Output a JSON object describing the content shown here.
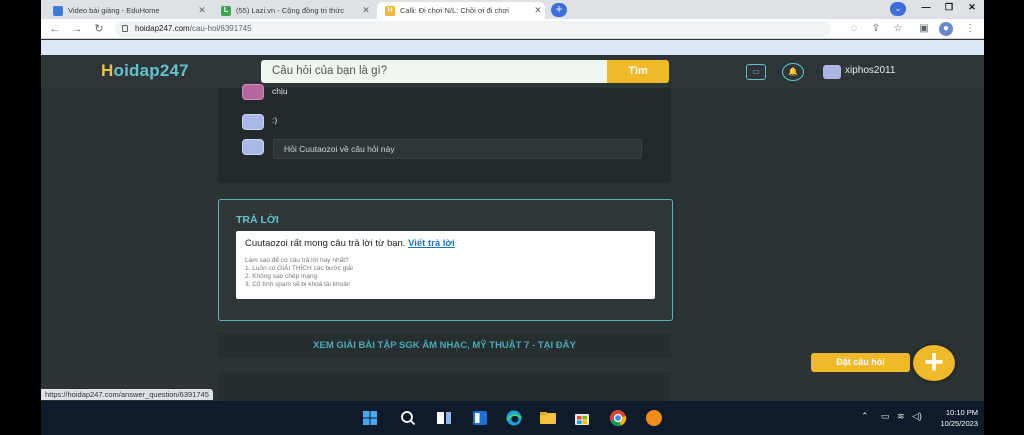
{
  "browser": {
    "tabs": [
      {
        "title": "Video bài giảng - EduHome",
        "favicon_color": "#3d7dd8",
        "favicon_letter": ""
      },
      {
        "title": "(55) Lazi.vn - Cộng đồng tri thức",
        "favicon_color": "#3fa34d",
        "favicon_letter": "L"
      },
      {
        "title": "Calli: Đi chơi N/L: Chồi ơi đi chơi",
        "favicon_color": "#f0b92a",
        "favicon_letter": "H"
      }
    ],
    "new_tab_label": "+",
    "address": {
      "domain": "hoidap247.com",
      "path": "/cau-hoi/6391745"
    },
    "status_url": "https://hoidap247.com/answer_question/6391745"
  },
  "site": {
    "logo_h": "H",
    "logo_rest": "oidap247",
    "search_placeholder": "Câu hỏi của bạn là gì?",
    "search_button": "Tìm",
    "username": "xiphos2011"
  },
  "comments": {
    "partial_text": "chịu",
    "smile_text": ":)",
    "input_placeholder": "Hỏi Cuutaozoi về câu hỏi này"
  },
  "answer": {
    "title": "TRẢ LỜI",
    "prompt": "Cuutaozoi rất mong câu trả lời từ bạn.",
    "link": "Viết trả lời",
    "tips": [
      "Làm sao để có câu trả lời hay nhất?",
      "1. Luôn có GIẢI THÍCH các bước giải",
      "2. Không sao chép mạng",
      "3. Cố tình spam sẽ bị khoá tài khoản"
    ]
  },
  "banner": "XEM GIẢI BÀI TẬP SGK ÂM NHẠC, MỸ THUẬT 7 - TẠI ĐÂY",
  "fab_label": "Đặt câu hỏi",
  "taskbar": {
    "time": "10:10 PM",
    "date": "10/25/2023"
  },
  "colors": {
    "accent": "#62c3cf",
    "brand_yellow": "#f0b92a",
    "page_bg": "#2b3335"
  }
}
